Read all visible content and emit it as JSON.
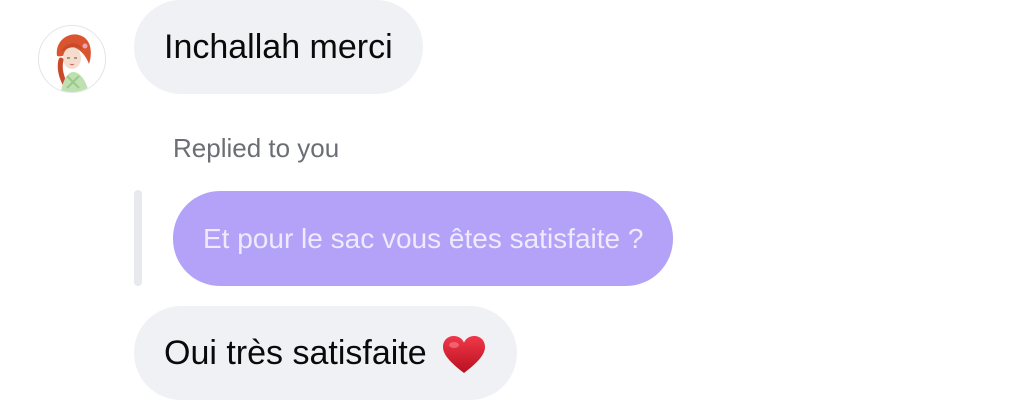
{
  "thread": {
    "message_1": {
      "text": "Inchallah merci"
    },
    "reply": {
      "label": "Replied to you",
      "quoted_text": "Et pour le sac vous êtes satisfaite ?"
    },
    "message_3": {
      "text": "Oui très satisfaite",
      "emoji": "red-heart"
    }
  },
  "colors": {
    "incoming_bubble": "#f0f1f5",
    "quoted_bubble": "#b3a2f7",
    "heart": "#d81e2f"
  },
  "icons": {
    "avatar": "illustrated-redhead-avatar",
    "emoji": "heart-icon"
  }
}
